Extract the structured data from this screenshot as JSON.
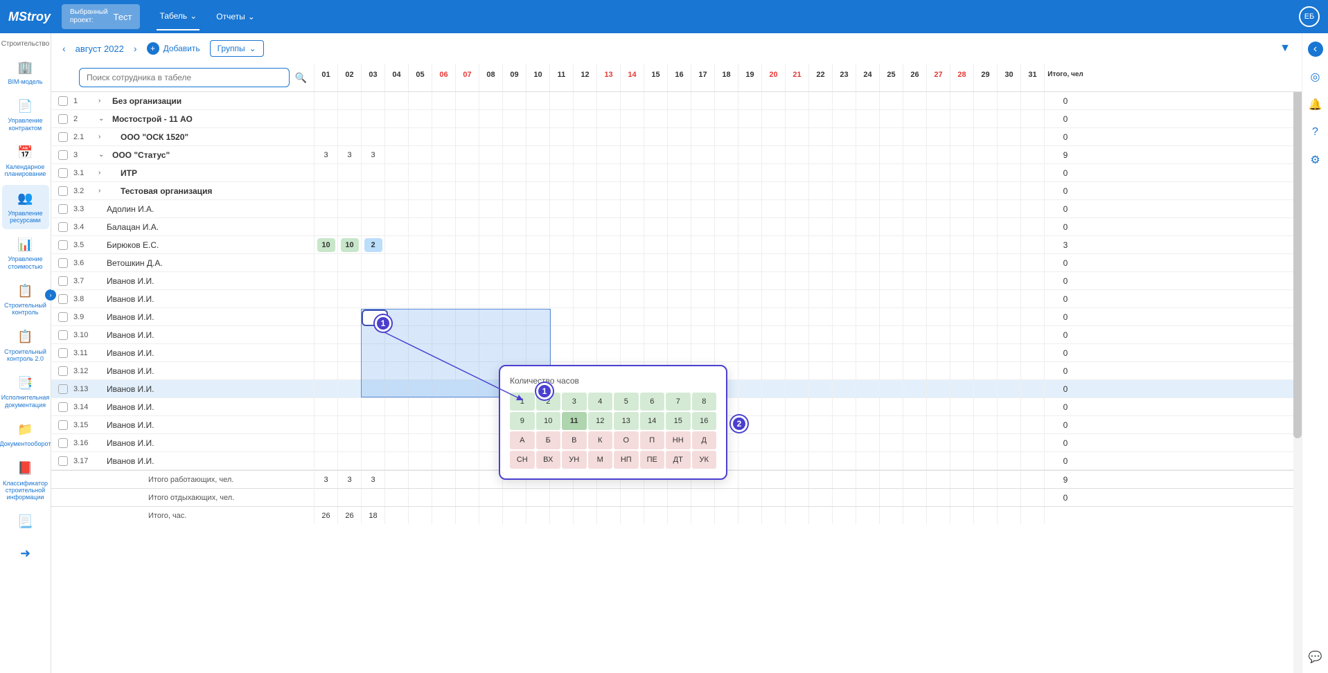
{
  "header": {
    "logo": "MStroy",
    "project_label": "Выбранный\nпроект:",
    "project_name": "Тест",
    "tabs": [
      {
        "label": "Табель",
        "active": true
      },
      {
        "label": "Отчеты",
        "active": false
      }
    ],
    "avatar": "ЕБ"
  },
  "sidebar": {
    "title": "Строительство",
    "items": [
      {
        "icon": "🏢",
        "label": "BIM-модель"
      },
      {
        "icon": "📄",
        "label": "Управление контрактом"
      },
      {
        "icon": "📅",
        "label": "Календарное планирование"
      },
      {
        "icon": "👥",
        "label": "Управление ресурсами",
        "active": true
      },
      {
        "icon": "📊",
        "label": "Управление стоимостью"
      },
      {
        "icon": "📋",
        "label": "Строительный контроль"
      },
      {
        "icon": "📋",
        "label": "Строительный контроль 2.0"
      },
      {
        "icon": "📑",
        "label": "Исполнительная документация"
      },
      {
        "icon": "📁",
        "label": "Документооборот"
      },
      {
        "icon": "📕",
        "label": "Классификатор строительной информации"
      },
      {
        "icon": "📃",
        "label": ""
      },
      {
        "icon": "➜",
        "label": ""
      }
    ]
  },
  "toolbar": {
    "month": "август 2022",
    "add": "Добавить",
    "groups": "Группы"
  },
  "search": {
    "placeholder": "Поиск сотрудника в табеле"
  },
  "days": [
    "01",
    "02",
    "03",
    "04",
    "05",
    "06",
    "07",
    "08",
    "09",
    "10",
    "11",
    "12",
    "13",
    "14",
    "15",
    "16",
    "17",
    "18",
    "19",
    "20",
    "21",
    "22",
    "23",
    "24",
    "25",
    "26",
    "27",
    "28",
    "29",
    "30",
    "31"
  ],
  "weekends": [
    5,
    6,
    12,
    13,
    19,
    20,
    26,
    27
  ],
  "total_header": "Итого, чел",
  "rows": [
    {
      "num": "1",
      "name": "Без организации",
      "bold": true,
      "exp": "›",
      "total": "0"
    },
    {
      "num": "2",
      "name": "Мостострой - 11 АО",
      "bold": true,
      "exp": "⌄",
      "total": "0"
    },
    {
      "num": "2.1",
      "name": "ООО \"ОСК 1520\"",
      "bold": true,
      "exp": "›",
      "indent": 1,
      "total": "0"
    },
    {
      "num": "3",
      "name": "ООО \"Статус\"",
      "bold": true,
      "exp": "⌄",
      "values": {
        "0": "3",
        "1": "3",
        "2": "3"
      },
      "total": "9"
    },
    {
      "num": "3.1",
      "name": "ИТР",
      "bold": true,
      "exp": "›",
      "indent": 1,
      "total": "0"
    },
    {
      "num": "3.2",
      "name": "Тестовая организация",
      "bold": true,
      "exp": "›",
      "indent": 1,
      "total": "0"
    },
    {
      "num": "3.3",
      "name": "Адолин И.А.",
      "indent": 1,
      "total": "0"
    },
    {
      "num": "3.4",
      "name": "Балацан И.А.",
      "indent": 1,
      "total": "0"
    },
    {
      "num": "3.5",
      "name": "Бирюков Е.С.",
      "indent": 1,
      "chips": {
        "0": {
          "v": "10",
          "c": "green"
        },
        "1": {
          "v": "10",
          "c": "green"
        },
        "2": {
          "v": "2",
          "c": "blue"
        }
      },
      "total": "3"
    },
    {
      "num": "3.6",
      "name": "Ветошкин Д.А.",
      "indent": 1,
      "total": "0"
    },
    {
      "num": "3.7",
      "name": "Иванов И.И.",
      "indent": 1,
      "total": "0"
    },
    {
      "num": "3.8",
      "name": "Иванов И.И.",
      "indent": 1,
      "total": "0"
    },
    {
      "num": "3.9",
      "name": "Иванов И.И.",
      "indent": 1,
      "total": "0"
    },
    {
      "num": "3.10",
      "name": "Иванов И.И.",
      "indent": 1,
      "total": "0"
    },
    {
      "num": "3.11",
      "name": "Иванов И.И.",
      "indent": 1,
      "total": "0"
    },
    {
      "num": "3.12",
      "name": "Иванов И.И.",
      "indent": 1,
      "total": "0"
    },
    {
      "num": "3.13",
      "name": "Иванов И.И.",
      "indent": 1,
      "highlight": true,
      "total": "0"
    },
    {
      "num": "3.14",
      "name": "Иванов И.И.",
      "indent": 1,
      "total": "0"
    },
    {
      "num": "3.15",
      "name": "Иванов И.И.",
      "indent": 1,
      "total": "0"
    },
    {
      "num": "3.16",
      "name": "Иванов И.И.",
      "indent": 1,
      "total": "0"
    },
    {
      "num": "3.17",
      "name": "Иванов И.И.",
      "indent": 1,
      "total": "0"
    }
  ],
  "footers": [
    {
      "label": "Итого работающих, чел.",
      "values": {
        "0": "3",
        "1": "3",
        "2": "3"
      },
      "total": "9"
    },
    {
      "label": "Итого отдыхающих, чел.",
      "values": {},
      "total": "0"
    },
    {
      "label": "Итого, час.",
      "values": {
        "0": "26",
        "1": "26",
        "2": "18"
      },
      "total": ""
    }
  ],
  "popup": {
    "title": "Количество часов",
    "hours": [
      "1",
      "2",
      "3",
      "4",
      "5",
      "6",
      "7",
      "8",
      "9",
      "10",
      "11",
      "12",
      "13",
      "14",
      "15",
      "16"
    ],
    "selected": 10,
    "codes": [
      "А",
      "Б",
      "В",
      "К",
      "О",
      "П",
      "НН",
      "Д",
      "СН",
      "ВХ",
      "УН",
      "М",
      "НП",
      "ПЕ",
      "ДТ",
      "УК"
    ]
  },
  "callouts": {
    "c1": "1",
    "c2": "1",
    "c3": "2"
  }
}
